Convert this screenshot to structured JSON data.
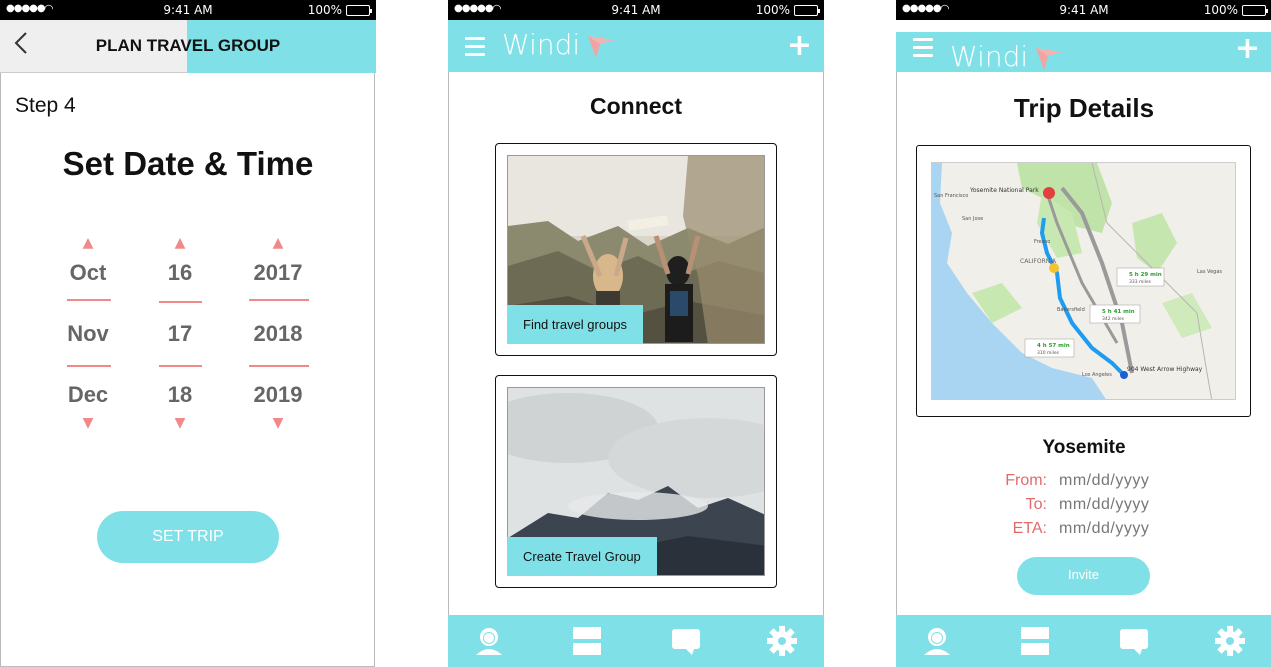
{
  "status_bar": {
    "signal": "●●●●●",
    "wifi": "wifi-icon",
    "time": "9:41 AM",
    "battery": "100%"
  },
  "screen1": {
    "title": "PLAN TRAVEL GROUP",
    "back_icon": "chevron-left-icon",
    "step": "Step 4",
    "heading": "Set Date & Time",
    "month_column": [
      "Oct",
      "Nov",
      "Dec"
    ],
    "day_column": [
      "16",
      "17",
      "18"
    ],
    "year_column": [
      "2017",
      "2018",
      "2019"
    ],
    "up_arrow": "▲",
    "down_arrow": "▼",
    "button_label": "SET TRIP"
  },
  "screen2": {
    "logo": "Windi",
    "menu_icon": "hamburger-menu-icon",
    "plus_icon": "+",
    "heading": "Connect",
    "cards": [
      {
        "label": "Find travel groups",
        "image": "two-hikers-on-cliff-photo"
      },
      {
        "label": "Create Travel Group",
        "image": "misty-mountain-photo"
      }
    ],
    "tabs": [
      "profile-icon",
      "feed-icon",
      "chat-icon",
      "settings-icon"
    ]
  },
  "screen3": {
    "logo": "Windi",
    "plus_icon": "+",
    "heading": "Trip Details",
    "map": {
      "state_label": "CALIFORNIA",
      "cities": [
        "Yosemite National Park",
        "San Francisco",
        "San Jose",
        "Fresno",
        "Las Vegas",
        "Bakersfield",
        "Los Angeles",
        "904 West Arrow Highway"
      ],
      "routes": [
        {
          "time": "5 h 29 min",
          "distance": "333 miles"
        },
        {
          "time": "5 h 41 min",
          "distance": "342 miles"
        },
        {
          "time": "4 h 57 min",
          "distance": "310 miles"
        }
      ]
    },
    "place": "Yosemite",
    "details": [
      {
        "label": "From:",
        "value": "mm/dd/yyyy"
      },
      {
        "label": "To:",
        "value": "mm/dd/yyyy"
      },
      {
        "label": "ETA:",
        "value": "mm/dd/yyyy"
      }
    ],
    "button_label": "Invite",
    "tabs": [
      "profile-icon",
      "feed-icon",
      "chat-icon",
      "settings-icon"
    ]
  },
  "colors": {
    "accent": "#7fe1e7",
    "arrow": "#f08a8a",
    "label_red": "#e36a6a"
  }
}
